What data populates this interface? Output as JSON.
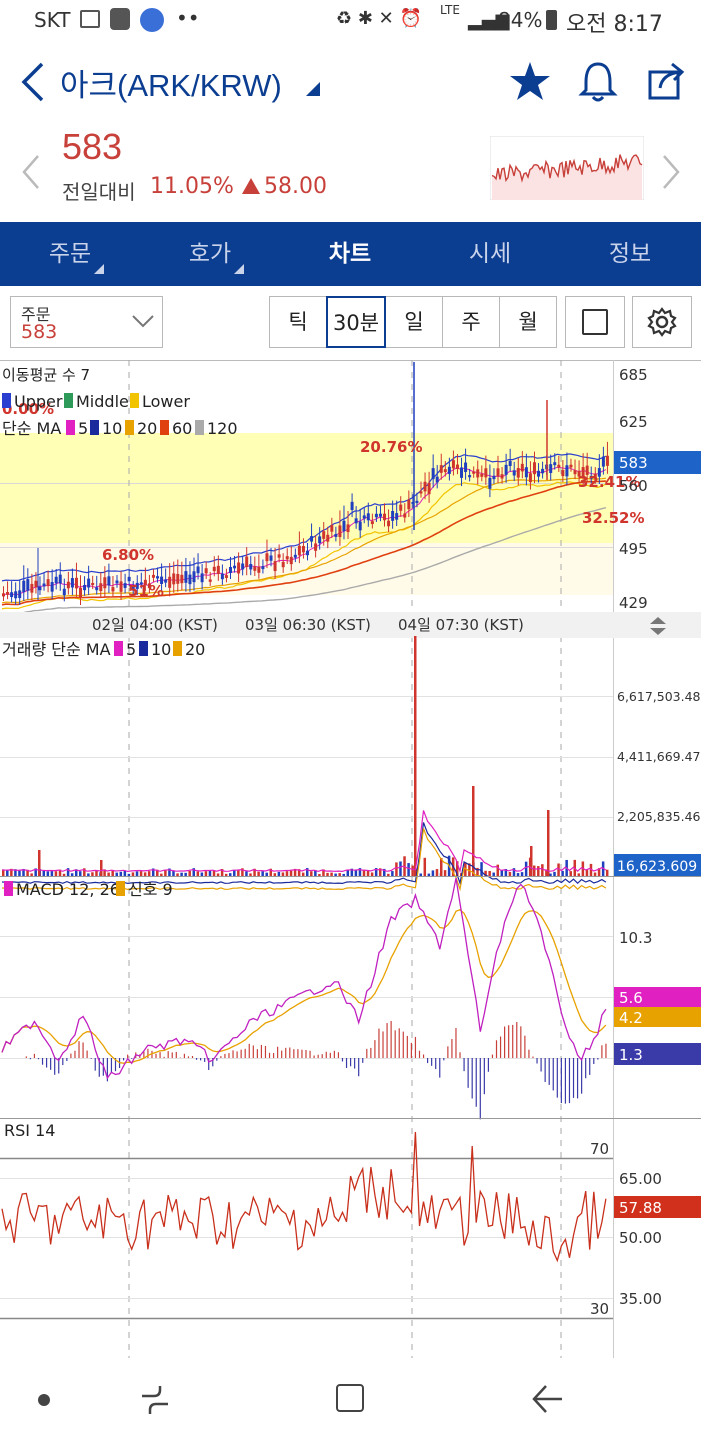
{
  "status": {
    "carrier": "SKT",
    "battery": "84%",
    "time": "오전 8:17",
    "lte": "LTE"
  },
  "header": {
    "title": "아크(ARK/KRW)"
  },
  "quote": {
    "price": "583",
    "change_label": "전일대비",
    "change_pct": "11.05%",
    "change_abs": "58.00"
  },
  "tabs": [
    {
      "label": "주문",
      "has_menu": true
    },
    {
      "label": "호가",
      "has_menu": true
    },
    {
      "label": "차트",
      "active": true
    },
    {
      "label": "시세"
    },
    {
      "label": "정보"
    }
  ],
  "order_box": {
    "label": "주문",
    "value": "583"
  },
  "timeframes": [
    "틱",
    "30분",
    "일",
    "주",
    "월"
  ],
  "selected_timeframe": "30분",
  "colors": {
    "brand": "#0b3d91",
    "up": "#d0352d",
    "candle_dn": "#1f3fbf",
    "ma5": "#e020c0",
    "ma10": "#1a2a9c",
    "ma20": "#e8a200",
    "ma60": "#e04010",
    "ma120": "#aaaaaa",
    "price_tag": "#1e63c8",
    "macd_tag": "#e020c0",
    "signal_tag": "#e8a200",
    "hist_tag": "#3a3aa8",
    "rsi_tag": "#d0301c"
  },
  "price_panel": {
    "legend_bb": "이동평균 수 7",
    "legend_overlap": "0.00%",
    "bb_items": [
      "Upper",
      "Middle",
      "Lower"
    ],
    "ma_label": "단순 MA",
    "ma_items": [
      "5",
      "10",
      "20",
      "60",
      "120"
    ],
    "y_ticks": [
      "685",
      "625",
      "560",
      "495",
      "429"
    ],
    "current": "583",
    "annotations": [
      "20.76%",
      "6.80%",
      "32.52%",
      "32.41%",
      "51%"
    ]
  },
  "time_axis": [
    "02일 04:00 (KST)",
    "03일 06:30 (KST)",
    "04일 07:30 (KST)"
  ],
  "volume_panel": {
    "label": "거래량 단순 MA",
    "ma_items": [
      "5",
      "10",
      "20"
    ],
    "y_ticks": [
      "6,617,503.481",
      "4,411,669.471",
      "2,205,835.462"
    ],
    "current": "16,623.609"
  },
  "macd_panel": {
    "label": "MACD 12, 26",
    "signal_label": "신호 9",
    "y_tick": "10.3",
    "macd_value": "5.6",
    "signal_value": "4.2",
    "hist_value": "1.3"
  },
  "rsi_panel": {
    "label": "RSI 14",
    "y_ticks": [
      "65.00",
      "50.00",
      "35.00"
    ],
    "upper": "70",
    "lower": "30",
    "current": "57.88"
  }
}
